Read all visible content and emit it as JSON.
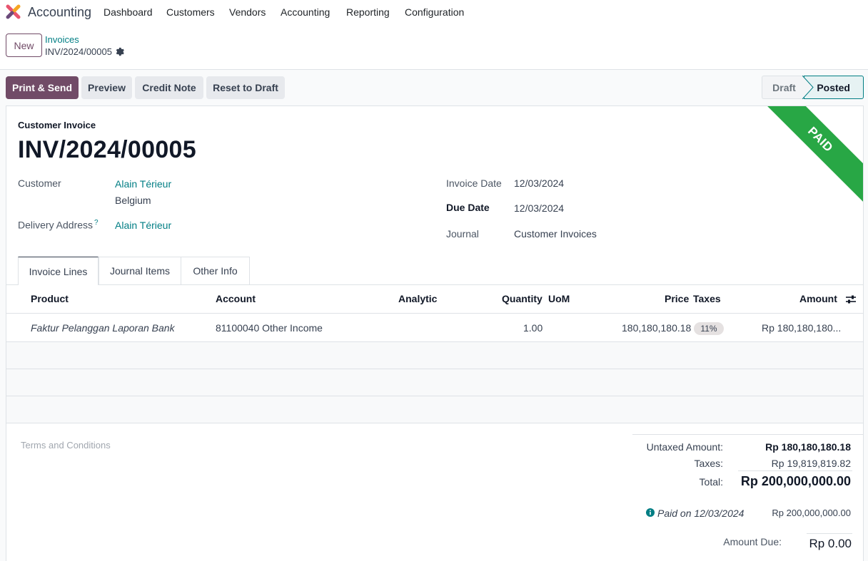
{
  "navbar": {
    "app_name": "Accounting",
    "menu": [
      "Dashboard",
      "Customers",
      "Vendors",
      "Accounting",
      "Reporting",
      "Configuration"
    ]
  },
  "control_panel": {
    "new_label": "New",
    "breadcrumb_parent": "Invoices",
    "breadcrumb_current": "INV/2024/00005"
  },
  "actions": {
    "print_send": "Print & Send",
    "preview": "Preview",
    "credit_note": "Credit Note",
    "reset_to_draft": "Reset to Draft"
  },
  "status": {
    "draft": "Draft",
    "posted": "Posted",
    "active": "Posted"
  },
  "ribbon": {
    "text": "PAID",
    "color": "#28a745"
  },
  "invoice": {
    "type_label": "Customer Invoice",
    "number": "INV/2024/00005",
    "customer_label": "Customer",
    "customer_name": "Alain Térieur",
    "customer_country": "Belgium",
    "delivery_label": "Delivery Address",
    "delivery_help": "?",
    "delivery_name": "Alain Térieur",
    "invoice_date_label": "Invoice Date",
    "invoice_date": "12/03/2024",
    "due_date_label": "Due Date",
    "due_date": "12/03/2024",
    "journal_label": "Journal",
    "journal": "Customer Invoices"
  },
  "tabs": [
    {
      "label": "Invoice Lines",
      "active": true
    },
    {
      "label": "Journal Items",
      "active": false
    },
    {
      "label": "Other Info",
      "active": false
    }
  ],
  "table": {
    "headers": {
      "product": "Product",
      "account": "Account",
      "analytic": "Analytic",
      "quantity": "Quantity",
      "uom": "UoM",
      "price": "Price",
      "taxes": "Taxes",
      "amount": "Amount"
    },
    "rows": [
      {
        "product": "Faktur Pelanggan Laporan Bank",
        "account": "81100040 Other Income",
        "analytic": "",
        "quantity": "1.00",
        "uom": "",
        "price": "180,180,180.18",
        "taxes": "11%",
        "amount": "Rp 180,180,180..."
      }
    ]
  },
  "terms_placeholder": "Terms and Conditions",
  "totals": {
    "untaxed_label": "Untaxed Amount:",
    "untaxed_value": "Rp 180,180,180.18",
    "taxes_label": "Taxes:",
    "taxes_value": "Rp 19,819,819.82",
    "total_label": "Total:",
    "total_value": "Rp 200,000,000.00",
    "payment_label": "Paid on 12/03/2024",
    "payment_value": "Rp 200,000,000.00",
    "amount_due_label": "Amount Due:",
    "amount_due_value": "Rp 0.00"
  },
  "colors": {
    "brand": "#714b67",
    "link": "#017e84",
    "paid": "#28a745"
  }
}
